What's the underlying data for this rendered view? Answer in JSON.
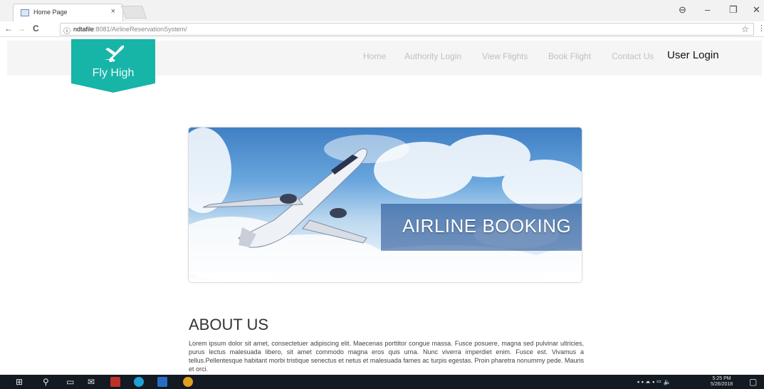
{
  "browser": {
    "tab_title": "Home Page",
    "tab_close": "×",
    "url_host": "ndtafile",
    "url_path": ":8081/AirlineReservationSystem/",
    "info_icon": "ⓘ",
    "back_icon": "←",
    "forward_icon": "→",
    "reload_icon": "C",
    "star_icon": "☆",
    "menu_icon": "⋮",
    "window_controls": {
      "profile": "⊖",
      "minimize": "–",
      "restore": "❐",
      "close": "✕"
    }
  },
  "site": {
    "brand": "Fly High",
    "brand_color": "#17b4a8",
    "nav": [
      {
        "label": "Home"
      },
      {
        "label": "Authority Login"
      },
      {
        "label": "View Flights"
      },
      {
        "label": "Book Flight"
      },
      {
        "label": "Contact Us"
      },
      {
        "label": "User Login"
      }
    ],
    "banner_title": "AIRLINE BOOKING",
    "about_heading": "ABOUT US",
    "about_text": "Lorem ipsum dolor sit amet, consectetuer adipiscing elit. Maecenas porttitor congue massa. Fusce posuere, magna sed pulvinar ultricies, purus lectus malesuada libero, sit amet commodo magna eros quis urna. Nunc viverra imperdiet enim. Fusce est. Vivamus a tellus.Pellentesque habitant morbi tristique senectus et netus et malesuada fames ac turpis egestas. Proin pharetra nonummy pede. Mauris et orci."
  },
  "taskbar": {
    "clock_time": "5:25 PM",
    "clock_date": "5/26/2018"
  }
}
